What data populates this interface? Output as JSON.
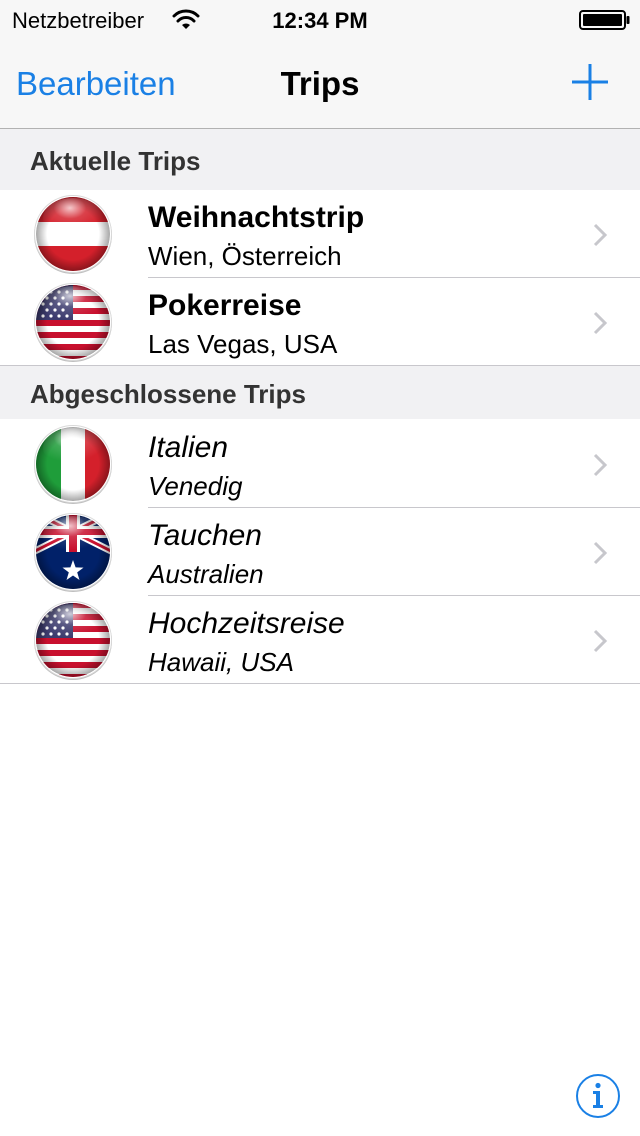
{
  "status_bar": {
    "carrier": "Netzbetreiber",
    "time": "12:34 PM",
    "wifi_icon": "wifi-icon",
    "battery_icon": "battery-icon"
  },
  "nav": {
    "edit_label": "Bearbeiten",
    "title": "Trips",
    "add_icon": "plus-icon"
  },
  "sections": [
    {
      "header": "Aktuelle Trips",
      "rows": [
        {
          "title": "Weihnachtstrip",
          "subtitle": "Wien, Österreich",
          "flag": "austria-flag-icon"
        },
        {
          "title": "Pokerreise",
          "subtitle": "Las Vegas, USA",
          "flag": "usa-flag-icon"
        }
      ]
    },
    {
      "header": "Abgeschlossene Trips",
      "rows": [
        {
          "title": "Italien",
          "subtitle": "Venedig",
          "flag": "italy-flag-icon"
        },
        {
          "title": "Tauchen",
          "subtitle": "Australien",
          "flag": "australia-flag-icon"
        },
        {
          "title": "Hochzeitsreise",
          "subtitle": "Hawaii, USA",
          "flag": "usa-flag-icon"
        }
      ]
    }
  ],
  "info_icon": "info-icon",
  "colors": {
    "accent": "#1a80e5",
    "bar_background": "#f7f7f7",
    "section_background": "#f1f1f3",
    "separator": "#c8c7cc",
    "chevron": "#c7c7cc"
  }
}
